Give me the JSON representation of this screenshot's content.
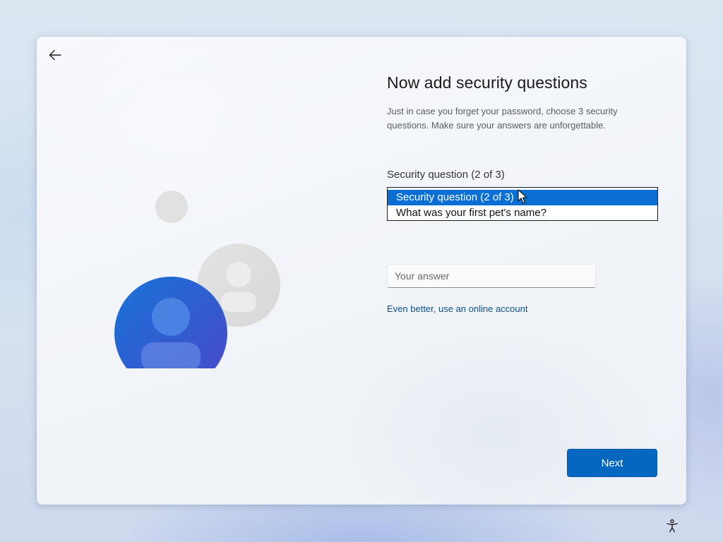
{
  "header": {
    "back_icon": "back-arrow-icon"
  },
  "main": {
    "title": "Now add security questions",
    "subtitle": "Just in case you forget your password, choose 3 security questions. Make sure your answers are unforgettable.",
    "question_label": "Security question (2 of 3)",
    "dropdown": {
      "options": [
        "Security question (2 of 3)",
        "What was your first pet's name?"
      ],
      "selected_index": 0
    },
    "answer": {
      "placeholder": "Your answer",
      "value": ""
    },
    "online_account_link": "Even better, use an online account",
    "next_button": "Next"
  },
  "footer": {
    "accessibility_icon": "accessibility-icon"
  },
  "colors": {
    "accent": "#0567c0",
    "selection": "#0a6fd4",
    "link": "#0b4f8a",
    "avatar_front": "#2f5fd6"
  }
}
